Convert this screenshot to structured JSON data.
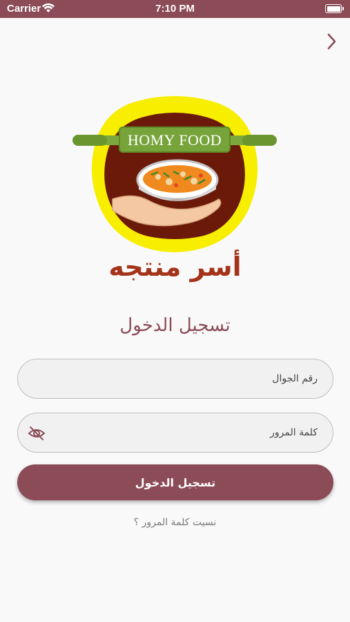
{
  "status_bar": {
    "carrier": "Carrier",
    "time": "7:10 PM"
  },
  "colors": {
    "primary": "#8b4b57",
    "brand_text": "#a4331a",
    "logo_yellow": "#f7ee00",
    "logo_brown": "#6b1a0a",
    "rolling_pin": "#7aa83c"
  },
  "nav": {
    "back_icon": "chevron-right-icon"
  },
  "logo": {
    "banner_text": "HOMY FOOD",
    "brand_name": "أسر منتجه"
  },
  "form": {
    "title": "تسجيل الدخول",
    "phone_placeholder": "رقم الجوال",
    "password_placeholder": "كلمة المرور",
    "password_toggle_icon": "eye-off-icon",
    "submit_label": "تسجيل الدخول",
    "forgot_password": "نسيت كلمة المرور ؟"
  }
}
